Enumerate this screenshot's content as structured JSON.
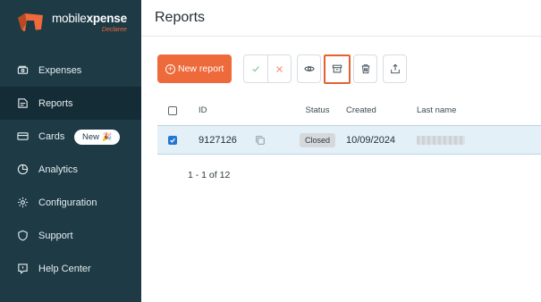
{
  "brand": {
    "name_light": "mobile",
    "name_bold": "xpense",
    "sub": "Declaree"
  },
  "nav": {
    "items": [
      {
        "label": "Expenses"
      },
      {
        "label": "Reports"
      },
      {
        "label": "Cards",
        "badge": "New",
        "badge_icon": "🎉"
      },
      {
        "label": "Analytics"
      },
      {
        "label": "Configuration"
      },
      {
        "label": "Support"
      },
      {
        "label": "Help Center"
      }
    ]
  },
  "page": {
    "title": "Reports"
  },
  "toolbar": {
    "new_report_label": "New report"
  },
  "table": {
    "headers": {
      "id": "ID",
      "status": "Status",
      "created": "Created",
      "last_name": "Last name"
    },
    "rows": [
      {
        "id": "9127126",
        "status": "Closed",
        "created": "10/09/2024",
        "last_name_redacted": true
      }
    ]
  },
  "pagination": {
    "text": "1 - 1 of 12"
  },
  "colors": {
    "sidebar_bg": "#1d3a45",
    "accent": "#ee6a3a",
    "selected_row": "#e4f0f8",
    "checkbox": "#2476d2"
  }
}
